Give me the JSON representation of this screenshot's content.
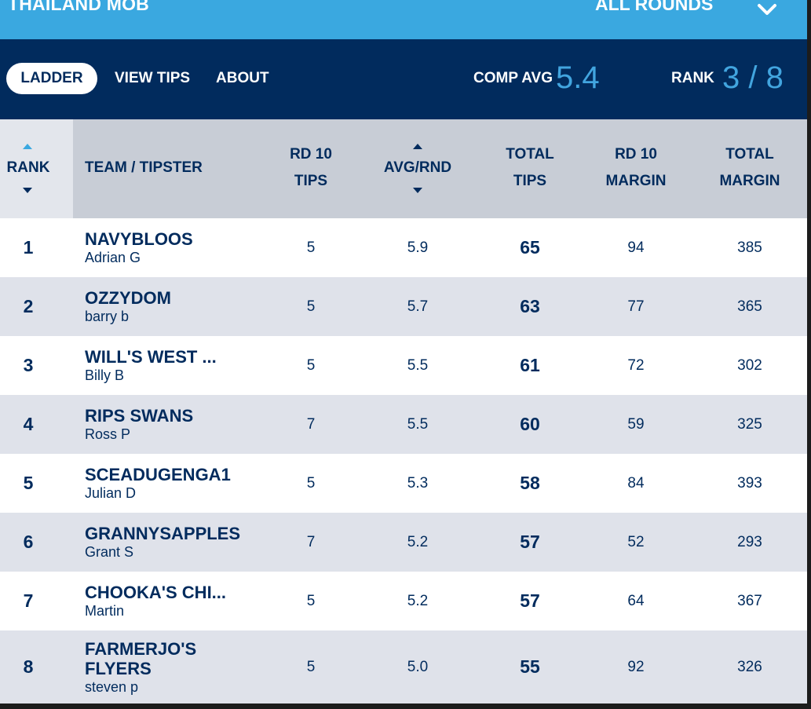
{
  "competition": {
    "name": "THAILAND MOB",
    "round_selector": "ALL ROUNDS"
  },
  "nav": {
    "tabs": [
      {
        "label": "LADDER",
        "active": true
      },
      {
        "label": "VIEW TIPS",
        "active": false
      },
      {
        "label": "ABOUT",
        "active": false
      }
    ]
  },
  "stats": {
    "comp_avg_label": "COMP AVG",
    "comp_avg_value": "5.4",
    "rank_label": "RANK",
    "rank_value": "3 / 8"
  },
  "table": {
    "headers": {
      "rank": "RANK",
      "team": "TEAM / TIPSTER",
      "rd_tips": [
        "RD 10",
        "TIPS"
      ],
      "avg": "AVG/RND",
      "total_tips": [
        "TOTAL",
        "TIPS"
      ],
      "rd_margin": [
        "RD 10",
        "MARGIN"
      ],
      "total_margin": [
        "TOTAL",
        "MARGIN"
      ]
    },
    "rows": [
      {
        "rank": "1",
        "team": "NAVYBLOOS",
        "tipster": "Adrian G",
        "rd_tips": "5",
        "avg": "5.9",
        "total_tips": "65",
        "rd_margin": "94",
        "total_margin": "385"
      },
      {
        "rank": "2",
        "team": "OZZYDOM",
        "tipster": "barry b",
        "rd_tips": "5",
        "avg": "5.7",
        "total_tips": "63",
        "rd_margin": "77",
        "total_margin": "365"
      },
      {
        "rank": "3",
        "team": "WILL'S WEST ...",
        "tipster": "Billy B",
        "rd_tips": "5",
        "avg": "5.5",
        "total_tips": "61",
        "rd_margin": "72",
        "total_margin": "302"
      },
      {
        "rank": "4",
        "team": "RIPS SWANS",
        "tipster": "Ross P",
        "rd_tips": "7",
        "avg": "5.5",
        "total_tips": "60",
        "rd_margin": "59",
        "total_margin": "325"
      },
      {
        "rank": "5",
        "team": "SCEADUGENGA1",
        "tipster": "Julian D",
        "rd_tips": "5",
        "avg": "5.3",
        "total_tips": "58",
        "rd_margin": "84",
        "total_margin": "393"
      },
      {
        "rank": "6",
        "team": "GRANNYSAPPLES",
        "tipster": "Grant S",
        "rd_tips": "7",
        "avg": "5.2",
        "total_tips": "57",
        "rd_margin": "52",
        "total_margin": "293"
      },
      {
        "rank": "7",
        "team": "CHOOKA'S CHI...",
        "tipster": "Martin",
        "rd_tips": "5",
        "avg": "5.2",
        "total_tips": "57",
        "rd_margin": "64",
        "total_margin": "367"
      },
      {
        "rank": "8",
        "team": "FARMERJO'S FLYERS",
        "tipster": "steven p",
        "rd_tips": "5",
        "avg": "5.0",
        "total_tips": "55",
        "rd_margin": "92",
        "total_margin": "326"
      }
    ]
  },
  "colors": {
    "navy": "#012b5d",
    "accent": "#3aa8e0",
    "stat_blue": "#42a5df",
    "row_alt": "#dfe2ea",
    "header_bg": "#c8cdd6"
  },
  "icons": {
    "round_selector": "chevron-down-icon",
    "sort_up": "sort-up-icon",
    "sort_down": "sort-down-icon"
  }
}
